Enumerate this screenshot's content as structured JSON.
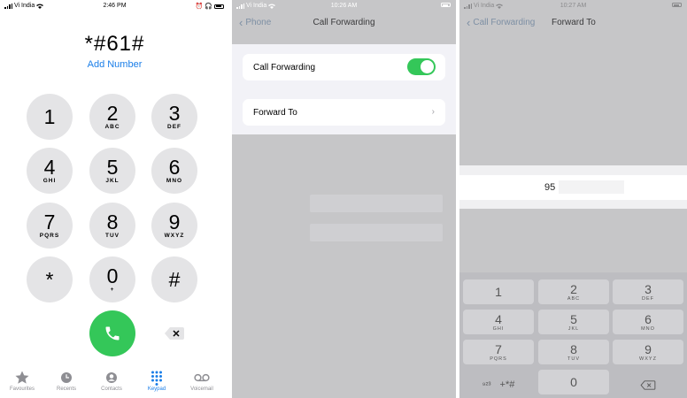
{
  "colors": {
    "accent": "#1a7ee8",
    "green": "#34c759",
    "overlay": "#c6c6c8"
  },
  "panel1": {
    "status": {
      "carrier": "Vi India",
      "time": "2:46 PM"
    },
    "dialed_number": "*#61#",
    "add_number": "Add Number",
    "keys": [
      {
        "digit": "1",
        "letters": ""
      },
      {
        "digit": "2",
        "letters": "ABC"
      },
      {
        "digit": "3",
        "letters": "DEF"
      },
      {
        "digit": "4",
        "letters": "GHI"
      },
      {
        "digit": "5",
        "letters": "JKL"
      },
      {
        "digit": "6",
        "letters": "MNO"
      },
      {
        "digit": "7",
        "letters": "PQRS"
      },
      {
        "digit": "8",
        "letters": "TUV"
      },
      {
        "digit": "9",
        "letters": "WXYZ"
      },
      {
        "digit": "*",
        "letters": ""
      },
      {
        "digit": "0",
        "letters": "+"
      },
      {
        "digit": "#",
        "letters": ""
      }
    ],
    "tabs": [
      {
        "label": "Favourites",
        "icon": "star-icon"
      },
      {
        "label": "Recents",
        "icon": "clock-icon"
      },
      {
        "label": "Contacts",
        "icon": "person-icon"
      },
      {
        "label": "Keypad",
        "icon": "keypad-icon",
        "active": true
      },
      {
        "label": "Voicemail",
        "icon": "voicemail-icon"
      }
    ]
  },
  "panel2": {
    "status": {
      "carrier": "Vi India",
      "time": "10:26 AM"
    },
    "back_label": "Phone",
    "title": "Call Forwarding",
    "call_forwarding_label": "Call Forwarding",
    "call_forwarding_on": true,
    "forward_to_label": "Forward To"
  },
  "panel3": {
    "status": {
      "carrier": "Vi India",
      "time": "10:27 AM"
    },
    "back_label": "Call Forwarding",
    "title": "Forward To",
    "number_prefix": "95",
    "keys": [
      {
        "digit": "1",
        "letters": ""
      },
      {
        "digit": "2",
        "letters": "ABC"
      },
      {
        "digit": "3",
        "letters": "DEF"
      },
      {
        "digit": "4",
        "letters": "GHI"
      },
      {
        "digit": "5",
        "letters": "JKL"
      },
      {
        "digit": "6",
        "letters": "MNO"
      },
      {
        "digit": "7",
        "letters": "PQRS"
      },
      {
        "digit": "8",
        "letters": "TUV"
      },
      {
        "digit": "9",
        "letters": "WXYZ"
      }
    ],
    "symbols_key": "+*#",
    "zero_key": "0"
  }
}
